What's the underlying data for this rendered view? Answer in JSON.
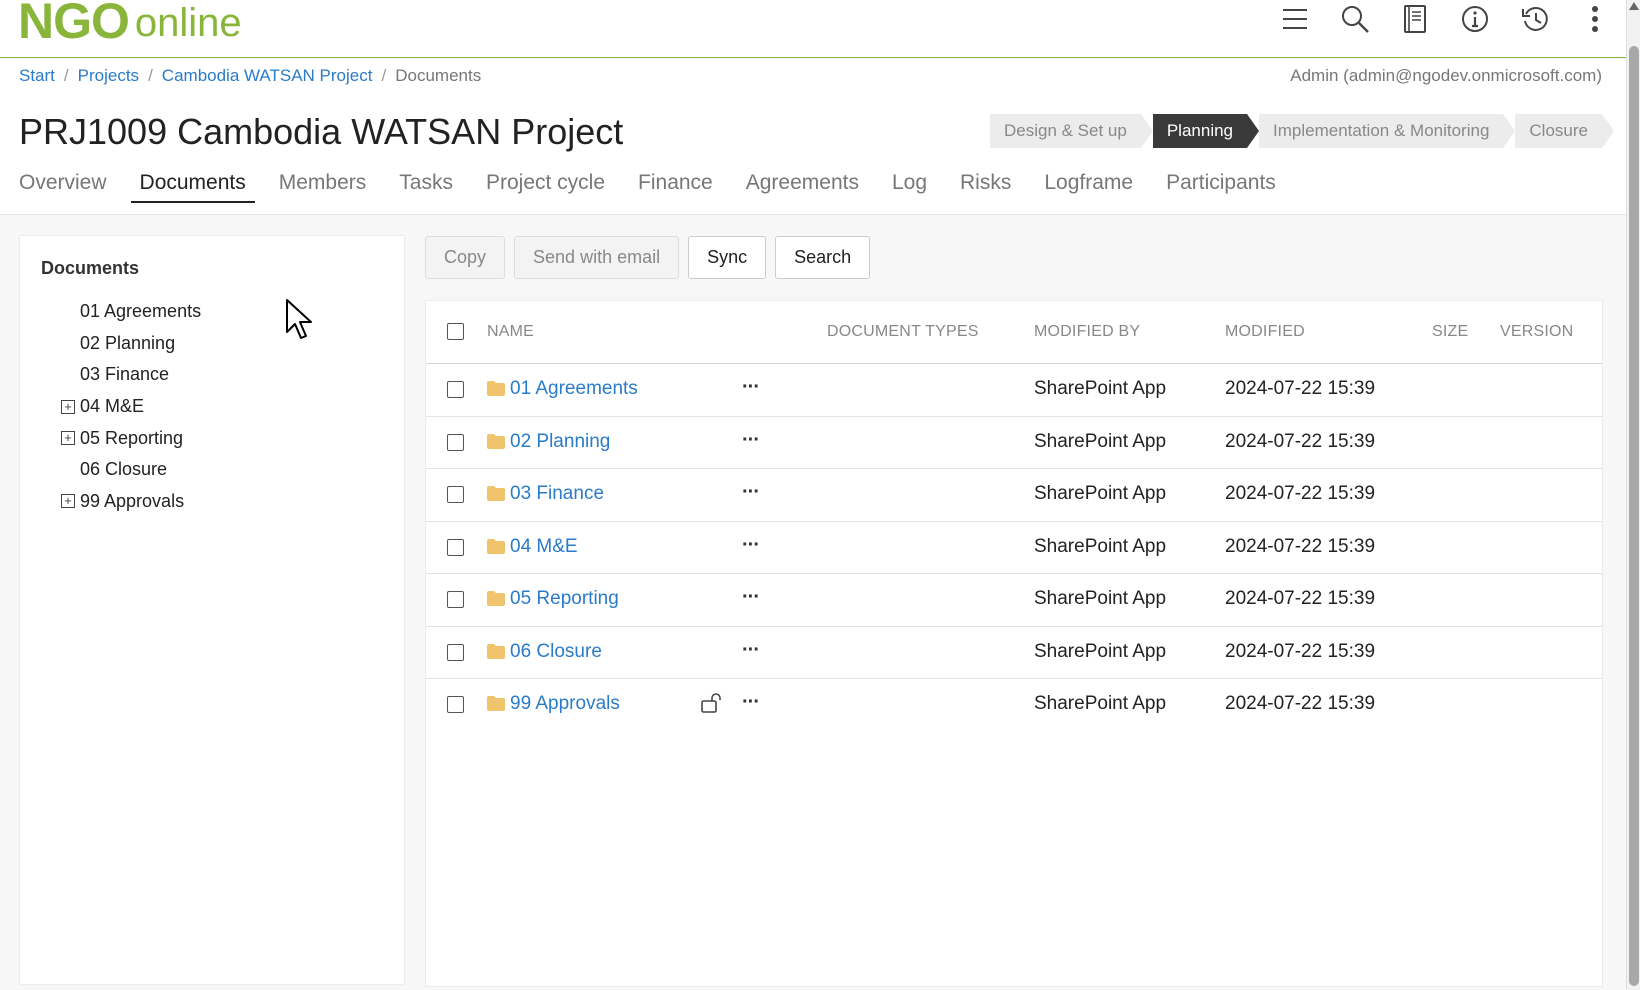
{
  "app": {
    "logo_part1": "NGO",
    "logo_part2": "online",
    "brand_color": "#8ab53b",
    "link_color": "#2a7bc9"
  },
  "top_icons": [
    "menu-icon",
    "search-icon",
    "book-icon",
    "info-icon",
    "history-icon",
    "more-vertical-icon"
  ],
  "breadcrumb": [
    "Start",
    "Projects",
    "Cambodia WATSAN Project",
    "Documents"
  ],
  "user": "Admin (admin@ngodev.onmicrosoft.com)",
  "page_title": "PRJ1009 Cambodia WATSAN Project",
  "stages": [
    "Design & Set up",
    "Planning",
    "Implementation & Monitoring",
    "Closure"
  ],
  "active_stage": "Planning",
  "tabs": [
    "Overview",
    "Documents",
    "Members",
    "Tasks",
    "Project cycle",
    "Finance",
    "Agreements",
    "Log",
    "Risks",
    "Logframe",
    "Participants"
  ],
  "active_tab": "Documents",
  "sidebar": {
    "title": "Documents",
    "items": [
      {
        "label": "01 Agreements",
        "expandable": false
      },
      {
        "label": "02 Planning",
        "expandable": false
      },
      {
        "label": "03 Finance",
        "expandable": false
      },
      {
        "label": "04 M&E",
        "expandable": true
      },
      {
        "label": "05 Reporting",
        "expandable": true
      },
      {
        "label": "06 Closure",
        "expandable": false
      },
      {
        "label": "99 Approvals",
        "expandable": true
      }
    ]
  },
  "toolbar": {
    "copy": "Copy",
    "send": "Send with email",
    "sync": "Sync",
    "search": "Search"
  },
  "table": {
    "headers": {
      "name": "NAME",
      "types": "DOCUMENT TYPES",
      "by": "MODIFIED BY",
      "modified": "MODIFIED",
      "size": "SIZE",
      "version": "VERSION"
    },
    "rows": [
      {
        "name": "01 Agreements",
        "by": "SharePoint App",
        "modified": "2024-07-22 15:39",
        "lock": false
      },
      {
        "name": "02 Planning",
        "by": "SharePoint App",
        "modified": "2024-07-22 15:39",
        "lock": false
      },
      {
        "name": "03 Finance",
        "by": "SharePoint App",
        "modified": "2024-07-22 15:39",
        "lock": false
      },
      {
        "name": "04 M&E",
        "by": "SharePoint App",
        "modified": "2024-07-22 15:39",
        "lock": false
      },
      {
        "name": "05 Reporting",
        "by": "SharePoint App",
        "modified": "2024-07-22 15:39",
        "lock": false
      },
      {
        "name": "06 Closure",
        "by": "SharePoint App",
        "modified": "2024-07-22 15:39",
        "lock": false
      },
      {
        "name": "99 Approvals",
        "by": "SharePoint App",
        "modified": "2024-07-22 15:39",
        "lock": true
      }
    ]
  },
  "row_menu_label": "···"
}
